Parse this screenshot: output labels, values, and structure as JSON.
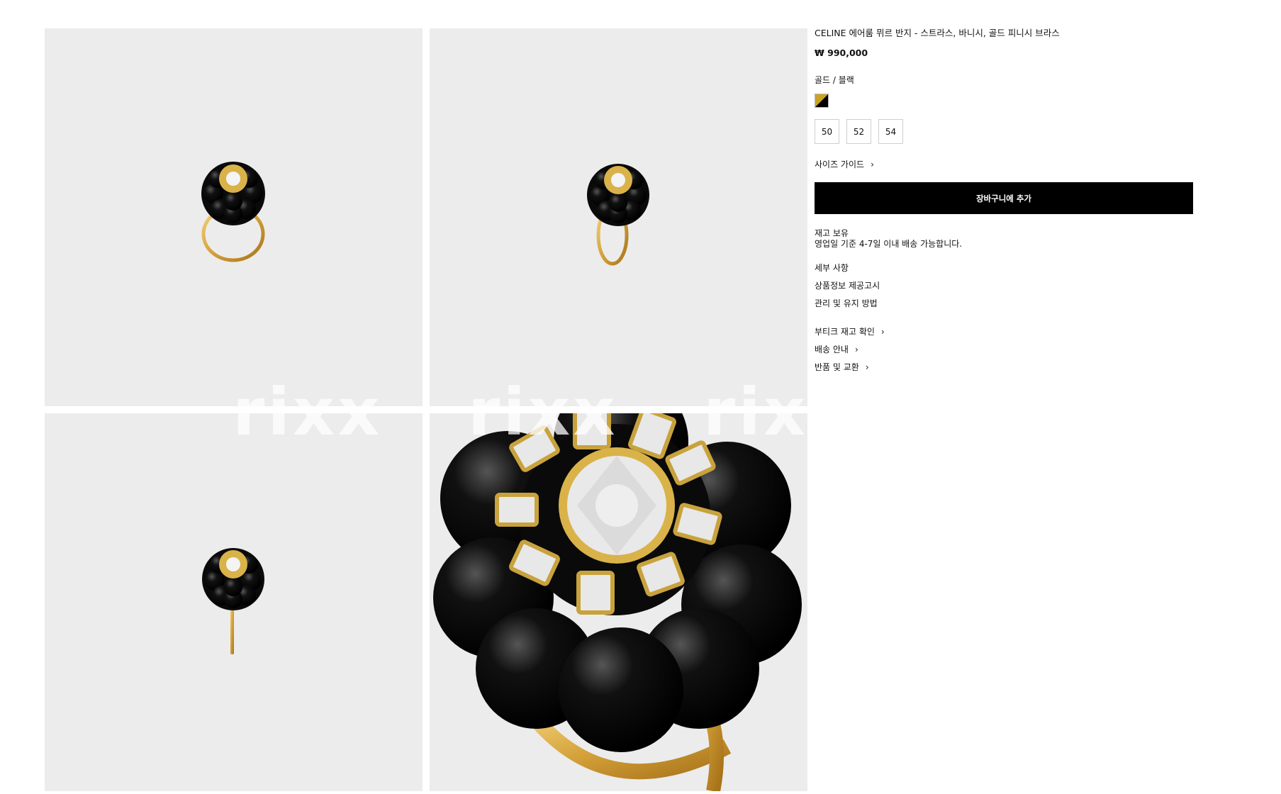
{
  "product": {
    "title": "CELINE 에어룸 뮈르 반지 - 스트라스, 바니시, 골드 피니시 브라스",
    "price": "₩ 990,000",
    "color_label": "골드 / 블랙",
    "swatch_colors": [
      "#c9a227",
      "#000000"
    ],
    "sizes": [
      "50",
      "52",
      "54"
    ],
    "size_guide": "사이즈 가이드",
    "add_to_cart": "장바구니에 추가",
    "stock_status": "재고 보유",
    "delivery_note": "영업일 기준 4-7일 이내 배송 가능합니다.",
    "sections": [
      "세부 사항",
      "상품정보 제공고시",
      "관리 및 유지 방법"
    ],
    "links": [
      "부티크 재고 확인",
      "배송 안내",
      "반품 및 교환"
    ]
  },
  "watermark": [
    "rixx",
    "rixx",
    "rixx"
  ],
  "icons": {
    "chevron": "chevron-right-icon"
  }
}
